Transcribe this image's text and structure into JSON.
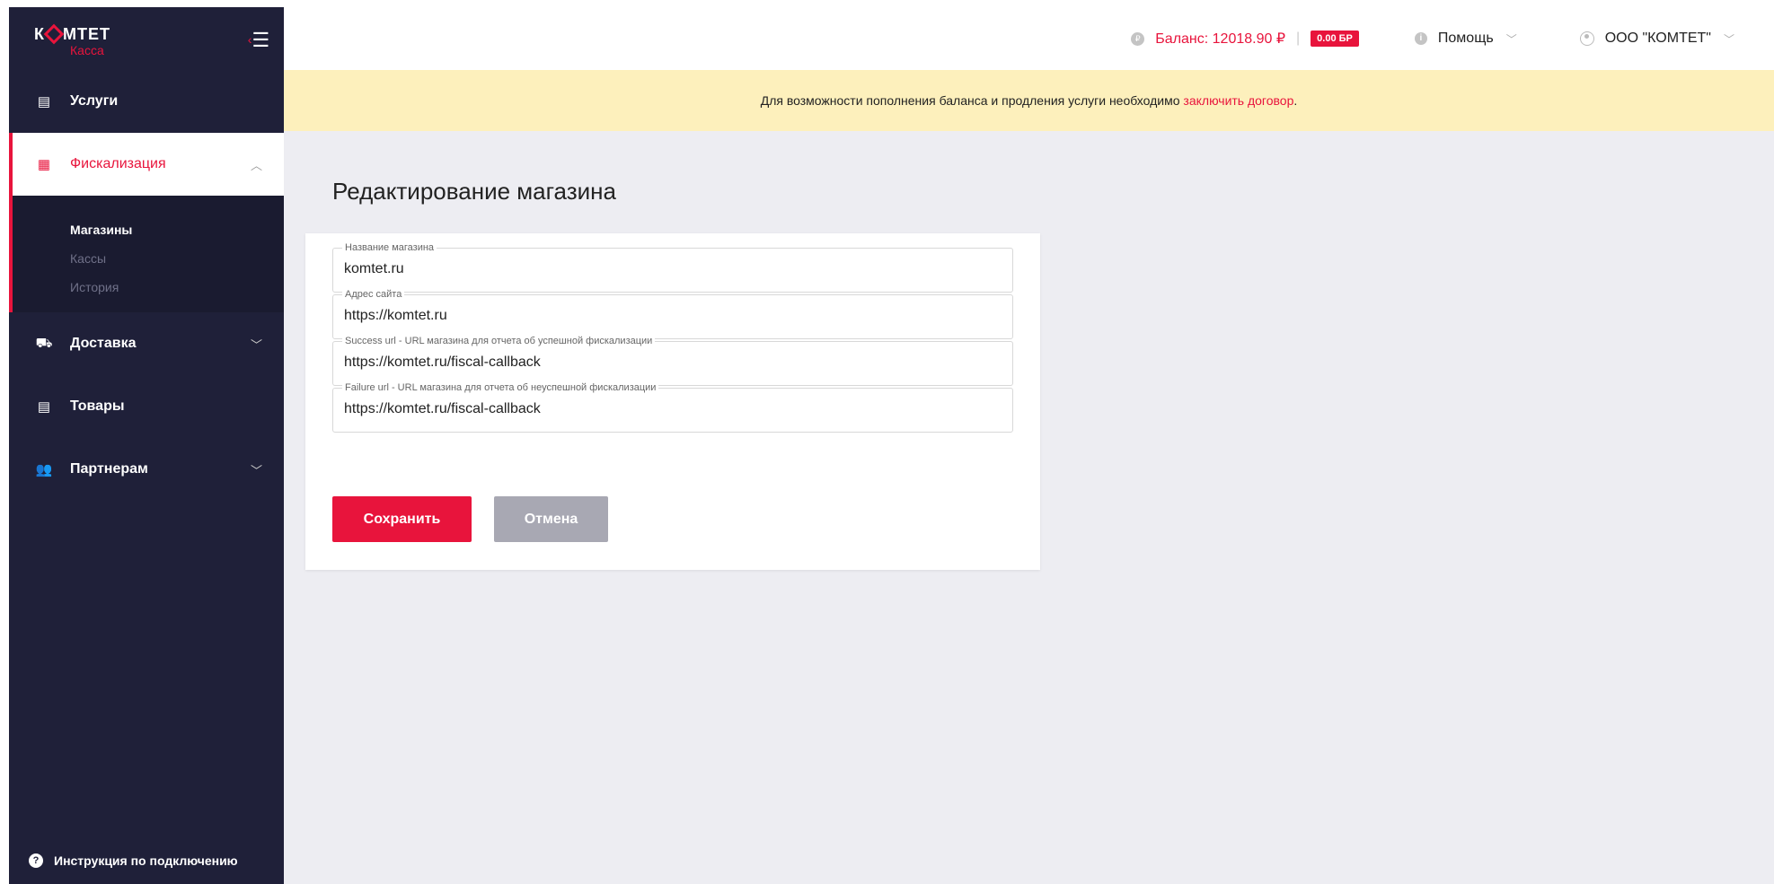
{
  "brand": {
    "name_left": "К",
    "name_right": "МТЕТ",
    "sub": "Касса",
    "accent_color": "#e8143c",
    "sidebar_color": "#1f2039"
  },
  "sidebar": {
    "collapse_icon": "menu-collapse-icon",
    "items": [
      {
        "label": "Услуги",
        "icon": "card-icon"
      },
      {
        "label": "Фискализация",
        "icon": "calculator-icon",
        "active": true,
        "submenu": [
          {
            "label": "Магазины",
            "current": true
          },
          {
            "label": "Кассы"
          },
          {
            "label": "История"
          }
        ]
      },
      {
        "label": "Доставка",
        "icon": "truck-icon"
      },
      {
        "label": "Товары",
        "icon": "list-icon"
      },
      {
        "label": "Партнерам",
        "icon": "users-icon"
      }
    ],
    "footer_link": "Инструкция по подключению"
  },
  "header": {
    "balance_label": "Баланс: 12018.90 ₽",
    "bonus_badge": "0.00 БР",
    "help_label": "Помощь",
    "account_label": "ООО \"КОМТЕТ\""
  },
  "notice": {
    "text": "Для возможности пополнения баланса и продления услуги необходимо ",
    "link": "заключить договор",
    "suffix": "."
  },
  "main": {
    "title": "Редактирование магазина",
    "fields": [
      {
        "label": "Название магазина",
        "value": "komtet.ru"
      },
      {
        "label": "Адрес сайта",
        "value": "https://komtet.ru"
      },
      {
        "label": "Success url - URL магазина для отчета об успешной фискализации",
        "value": "https://komtet.ru/fiscal-callback"
      },
      {
        "label": "Failure url - URL магазина для отчета об неуспешной фискализации",
        "value": "https://komtet.ru/fiscal-callback"
      }
    ],
    "save_label": "Сохранить",
    "cancel_label": "Отмена"
  }
}
